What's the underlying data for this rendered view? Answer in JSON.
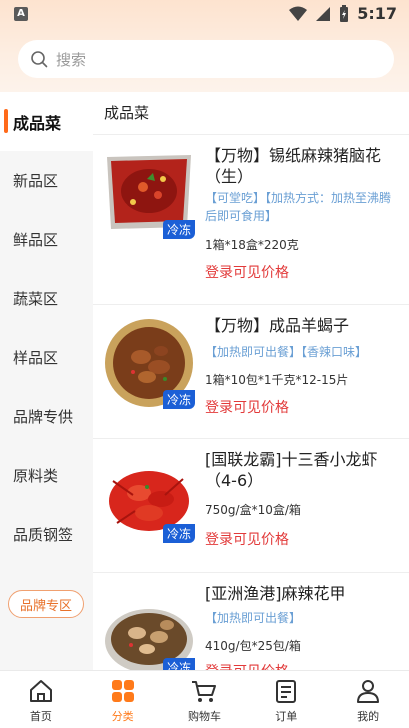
{
  "status_bar": {
    "time": "5:17",
    "left_badge": "A"
  },
  "search": {
    "placeholder": "搜索"
  },
  "sidebar": {
    "items": [
      {
        "label": "成品菜",
        "active": true
      },
      {
        "label": "新品区"
      },
      {
        "label": "鲜品区"
      },
      {
        "label": "蔬菜区"
      },
      {
        "label": "样品区"
      },
      {
        "label": "品牌专供"
      },
      {
        "label": "原料类"
      },
      {
        "label": "品质钢签"
      }
    ],
    "brand_zone_button": "品牌专区"
  },
  "main": {
    "section_title": "成品菜",
    "products": [
      {
        "name": "【万物】锡纸麻辣猪脑花（生）",
        "tags": "【可堂吃】【加热方式：加热至沸腾后即可食用】",
        "spec": "1箱*18盒*220克",
        "price_text": "登录可见价格",
        "badge": "冷冻"
      },
      {
        "name": "【万物】成品羊蝎子",
        "tags": "【加热即可出餐】【香辣口味】",
        "spec": "1箱*10包*1千克*12-15片",
        "price_text": "登录可见价格",
        "badge": "冷冻"
      },
      {
        "name": "[国联龙霸]十三香小龙虾（4-6）",
        "tags": "",
        "spec": "750g/盒*10盒/箱",
        "price_text": "登录可见价格",
        "badge": "冷冻"
      },
      {
        "name": "[亚洲渔港]麻辣花甲",
        "tags": "【加热即可出餐】",
        "spec": "410g/包*25包/箱",
        "price_text": "登录可见价格",
        "badge": "冷冻"
      }
    ]
  },
  "bottom_nav": [
    {
      "label": "首页",
      "icon": "home-icon"
    },
    {
      "label": "分类",
      "icon": "category-icon",
      "active": true
    },
    {
      "label": "购物车",
      "icon": "cart-icon"
    },
    {
      "label": "订单",
      "icon": "order-icon"
    },
    {
      "label": "我的",
      "icon": "profile-icon"
    }
  ],
  "colors": {
    "accent": "#ff6a1a",
    "price": "#e23a3a",
    "tag_blue": "#6a9fd4",
    "frozen_badge": "#1b5fd6"
  }
}
